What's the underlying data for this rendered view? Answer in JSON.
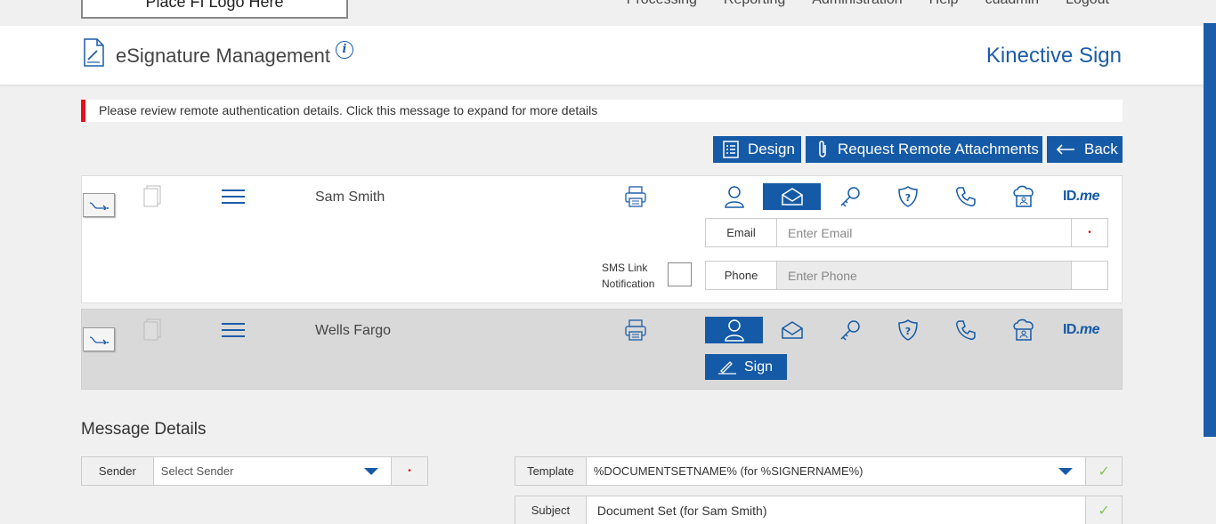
{
  "topbar": {
    "logo_text": "Place FI Logo Here",
    "nav": [
      "Processing",
      "Reporting",
      "Administration",
      "Help",
      "cuadmin",
      "Logout"
    ]
  },
  "header": {
    "title": "eSignature Management",
    "info_glyph": "i",
    "brand": "Kinective Sign"
  },
  "alert": {
    "message": "Please review remote authentication details. Click this message to expand for more details",
    "color": "#e8101e"
  },
  "actions": {
    "design_label": "Design",
    "attach_label": "Request Remote Attachments",
    "back_label": "Back"
  },
  "signers": [
    {
      "name": "Sam Smith",
      "page_count": "1",
      "active_auth": "email",
      "email_label": "Email",
      "email_placeholder": "Enter Email",
      "email_required": "•",
      "phone_label": "Phone",
      "phone_placeholder": "Enter Phone",
      "sms_label_line1": "SMS Link",
      "sms_label_line2": "Notification"
    },
    {
      "name": "Wells Fargo",
      "page_count": "1",
      "active_auth": "in-person",
      "sign_label": "Sign"
    }
  ],
  "auth_methods": [
    "person-icon",
    "email-icon",
    "key-icon",
    "shield-question-icon",
    "phone-icon",
    "cloud-id-icon",
    "idme-logo"
  ],
  "idme": {
    "id": "ID",
    "me": ".me"
  },
  "message_details": {
    "title": "Message Details",
    "sender_label": "Sender",
    "sender_value": "Select Sender",
    "sender_required": "•",
    "template_label": "Template",
    "template_value": "%DOCUMENTSETNAME% (for %SIGNERNAME%)",
    "subject_label": "Subject",
    "subject_value": "Document Set (for Sam Smith)",
    "check_glyph": "✓"
  },
  "colors": {
    "primary": "#155aa6",
    "alert": "#e8101e",
    "check": "#8bbf5a"
  }
}
